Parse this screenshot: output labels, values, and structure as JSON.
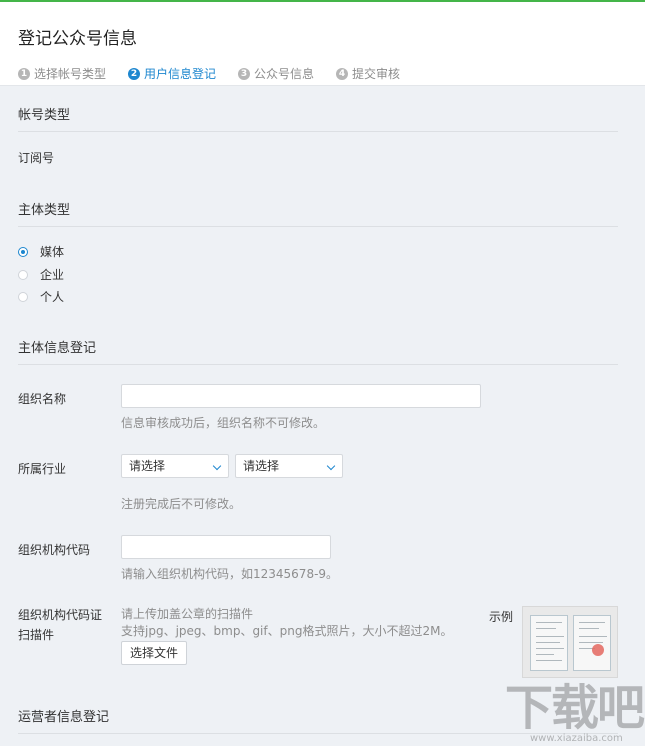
{
  "header": {
    "title": "登记公众号信息",
    "steps": [
      {
        "num": "1",
        "label": "选择帐号类型",
        "active": false
      },
      {
        "num": "2",
        "label": "用户信息登记",
        "active": true
      },
      {
        "num": "3",
        "label": "公众号信息",
        "active": false
      },
      {
        "num": "4",
        "label": "提交审核",
        "active": false
      }
    ]
  },
  "account_type": {
    "title": "帐号类型",
    "value": "订阅号"
  },
  "subject_type": {
    "title": "主体类型",
    "options": [
      {
        "label": "媒体",
        "checked": true
      },
      {
        "label": "企业",
        "checked": false
      },
      {
        "label": "个人",
        "checked": false
      }
    ]
  },
  "subject_info": {
    "title": "主体信息登记",
    "org_name": {
      "label": "组织名称",
      "value": "",
      "hint": "信息审核成功后，组织名称不可修改。"
    },
    "industry": {
      "label": "所属行业",
      "select1": "请选择",
      "select2": "请选择",
      "hint": "注册完成后不可修改。"
    },
    "org_code": {
      "label": "组织机构代码",
      "value": "",
      "hint": "请输入组织机构代码，如12345678-9。"
    },
    "scan": {
      "label_line1": "组织机构代码证",
      "label_line2": "扫描件",
      "hint1": "请上传加盖公章的扫描件",
      "hint2": "支持jpg、jpeg、bmp、gif、png格式照片，大小不超过2M。",
      "button": "选择文件",
      "example_label": "示例"
    }
  },
  "operator_info": {
    "title": "运营者信息登记"
  },
  "watermark": {
    "main": "下载吧",
    "sub": "www.xiazaiba.com"
  }
}
